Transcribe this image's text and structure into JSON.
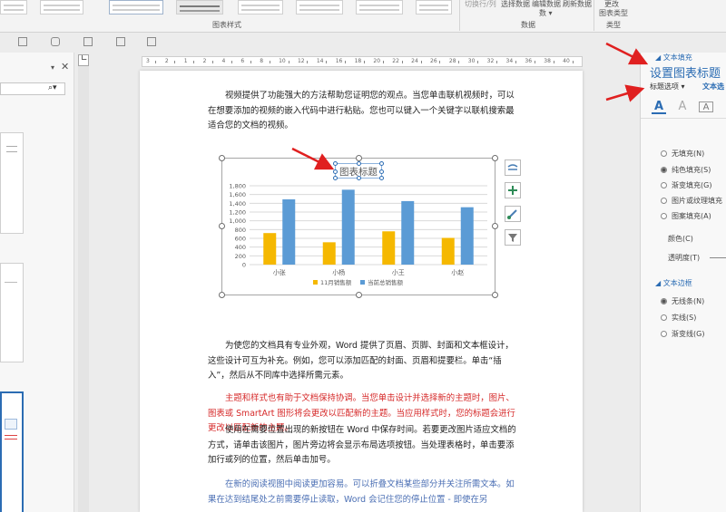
{
  "ribbon": {
    "group_chart_styles": "图表样式",
    "group_data": "数据",
    "group_type": "类型",
    "btn_switch_row_col": "切换行/列",
    "btn_select_data": "选择数据",
    "btn_edit_data": "编辑数据",
    "btn_refresh_data": "刷新数据",
    "btn_change_type_1": "更改",
    "btn_change_type_2": "图表类型"
  },
  "ruler": {
    "numbers": [
      "3",
      "2",
      "1",
      "2",
      "4",
      "6",
      "8",
      "10",
      "12",
      "14",
      "16",
      "18",
      "20",
      "22",
      "24",
      "26",
      "28",
      "30",
      "32",
      "34",
      "36",
      "38",
      "40"
    ]
  },
  "doc": {
    "p1": "视频提供了功能强大的方法帮助您证明您的观点。当您单击联机视频时，可以在想要添加的视频的嵌入代码中进行粘贴。您也可以键入一个关键字以联机搜索最适合您的文档的视频。",
    "p2": "为使您的文档具有专业外观，Word 提供了页眉、页脚、封面和文本框设计，这些设计可互为补充。例如，您可以添加匹配的封面、页眉和提要栏。单击“插入”，然后从不同库中选择所需元素。",
    "p3": "主题和样式也有助于文档保持协调。当您单击设计并选择新的主题时，图片、图表或 SmartArt 图形将会更改以匹配新的主题。当应用样式时，您的标题会进行更改以匹配新的主题。",
    "p4": "使用在需要位置出现的新按钮在 Word 中保存时间。若要更改图片适应文档的方式，请单击该图片，图片旁边将会显示布局选项按钮。当处理表格时，单击要添加行或列的位置，然后单击加号。",
    "p5": "在新的阅读视图中阅读更加容易。可以折叠文档某些部分并关注所需文本。如果在达到结尾处之前需要停止读取，Word 会记住您的停止位置 - 即使在另"
  },
  "chart_data": {
    "type": "bar",
    "title": "图表标题",
    "categories": [
      "小张",
      "小杨",
      "小王",
      "小赵"
    ],
    "series": [
      {
        "name": "11月销售额",
        "values": [
          720,
          510,
          760,
          610
        ],
        "color": "#f5b800"
      },
      {
        "name": "当前总销售额",
        "values": [
          1490,
          1710,
          1450,
          1310
        ],
        "color": "#5b9bd5"
      }
    ],
    "ylim": [
      0,
      1800
    ],
    "yticks": [
      0,
      200,
      400,
      600,
      800,
      1000,
      1200,
      1400,
      1600,
      1800
    ],
    "ytick_labels": [
      "0",
      "200",
      "400",
      "600",
      "800",
      "1,000",
      "1,200",
      "1,400",
      "1,600",
      "1,800"
    ],
    "grid": true,
    "legend": "bottom"
  },
  "pane": {
    "title": "设置图表标题",
    "tab_title_options": "标题选项",
    "tab_text_options": "文本选",
    "section_text_fill": "文本填充",
    "fill_none": "无填充(N)",
    "fill_solid": "纯色填充(S)",
    "fill_gradient": "渐变填充(G)",
    "fill_picture": "图片或纹理填充",
    "fill_pattern": "图案填充(A)",
    "color": "颜色(C)",
    "transparency": "透明度(T)",
    "section_text_outline": "文本边框",
    "line_none": "无线条(N)",
    "line_solid": "实线(S)",
    "line_gradient": "渐变线(G)"
  }
}
